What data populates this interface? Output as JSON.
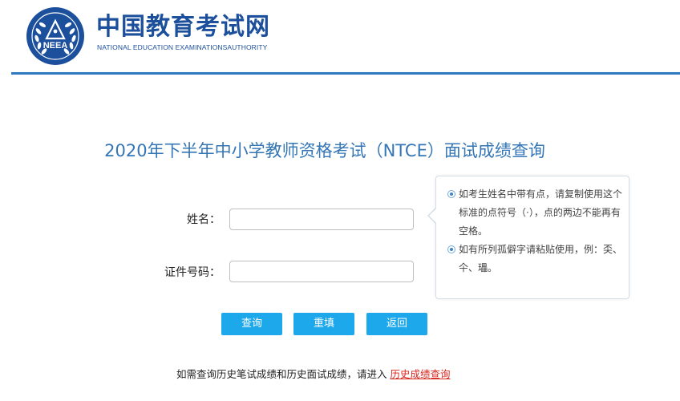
{
  "header": {
    "logo_text": "NEEA",
    "title": "中国教育考试网",
    "subtitle": "NATIONAL EDUCATION EXAMINATIONSAUTHORITY",
    "brand_color": "#1c4f9c",
    "rule_color": "#2e79bf"
  },
  "main": {
    "title": "2020年下半年中小学教师资格考试（NTCE）面试成绩查询",
    "form": {
      "name_label": "姓名：",
      "name_value": "",
      "id_label": "证件号码：",
      "id_value": ""
    },
    "tips": [
      "如考生姓名中带有点，请复制使用这个标准的点符号（·），点的两边不能再有空格。",
      "如有所列孤僻字请粘贴使用，例：奀、仐、瓃。"
    ],
    "buttons": {
      "query": "查询",
      "reset": "重填",
      "back": "返回",
      "color": "#1ea8ec"
    }
  },
  "footer": {
    "note": "如需查询历史笔试成绩和历史面试成绩，请进入",
    "link": "历史成绩查询",
    "link_color": "#d8251d"
  }
}
